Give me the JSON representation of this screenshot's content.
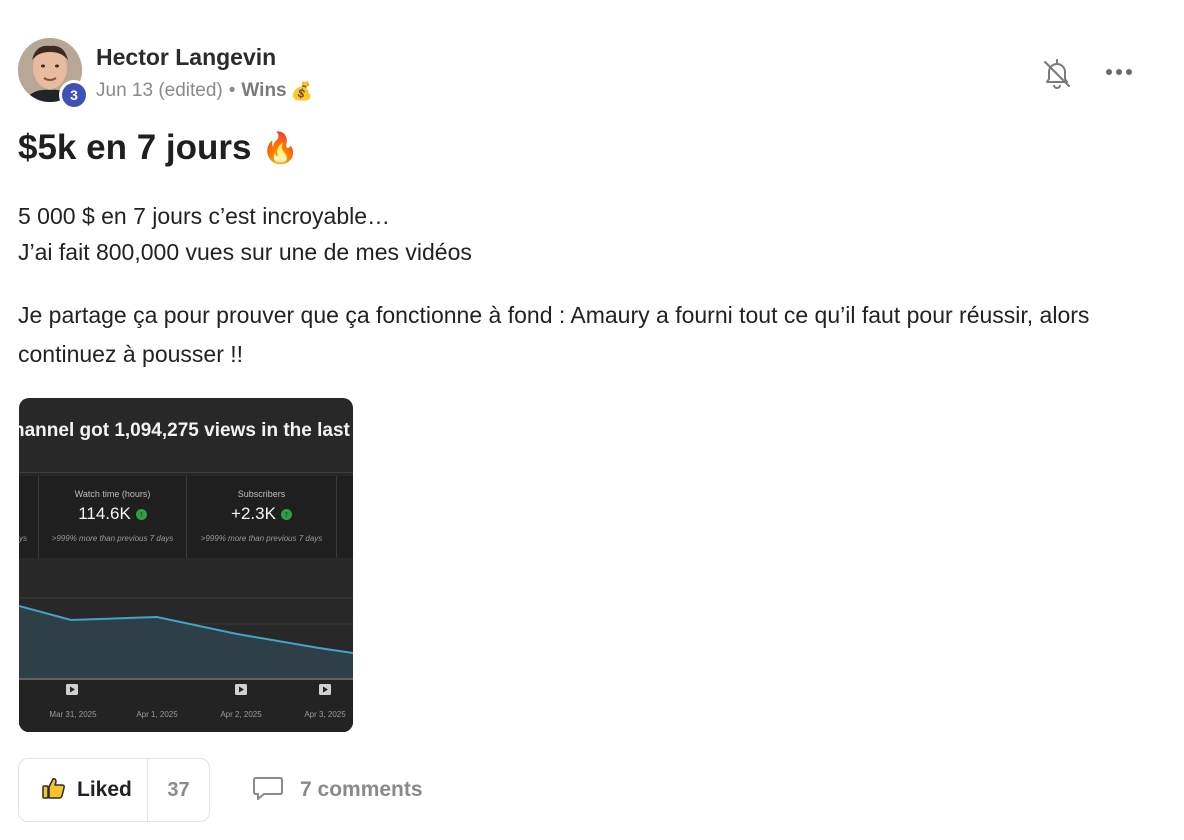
{
  "post": {
    "author": "Hector Langevin",
    "level": "3",
    "date": "Jun 13 (edited)",
    "separator": "•",
    "category": "Wins",
    "category_emoji": "💰",
    "title": "$5k en 7 jours",
    "title_emoji": "🔥",
    "body_line1": "5 000 $ en 7 jours c’est incroyable…",
    "body_line2": "J’ai fait 800,000 vues sur une de mes vidéos",
    "body_para2": "Je partage ça pour prouver que ça fonctionne à fond : Amaury a fourni tout ce qu’il faut pour réussir, alors continuez à pousser !!"
  },
  "attachment": {
    "headline": "hannel got 1,094,275 views in the last",
    "edge_text": "ys",
    "metrics": [
      {
        "label": "Watch time (hours)",
        "value": "114.6K",
        "note": ">999% more than previous 7 days"
      },
      {
        "label": "Subscribers",
        "value": "+2.3K",
        "note": ">999% more than previous 7 days"
      }
    ],
    "dates": [
      "Mar 31, 2025",
      "Apr 1, 2025",
      "Apr 2, 2025",
      "Apr 3, 2025"
    ],
    "line_color": "#41a5c7"
  },
  "actions": {
    "like_label": "Liked",
    "like_count": "37",
    "comments_label": "7 comments"
  },
  "icons": {
    "bell": "bell-off-icon",
    "more": "more-horizontal-icon",
    "like": "thumbs-up-icon",
    "comment": "comment-icon"
  }
}
